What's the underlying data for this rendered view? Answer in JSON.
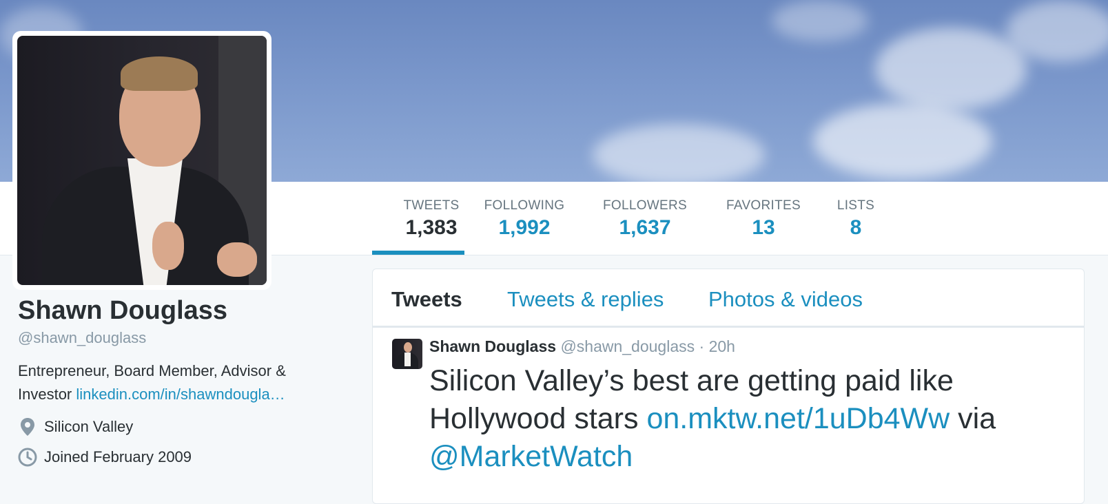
{
  "profile": {
    "name": "Shawn Douglass",
    "handle": "@shawn_douglass",
    "bio_text": "Entrepreneur, Board Member, Advisor & Investor",
    "bio_link": "linkedin.com/in/shawndougla…",
    "location": "Silicon Valley",
    "joined": "Joined February 2009"
  },
  "stats": [
    {
      "label": "TWEETS",
      "value": "1,383"
    },
    {
      "label": "FOLLOWING",
      "value": "1,992"
    },
    {
      "label": "FOLLOWERS",
      "value": "1,637"
    },
    {
      "label": "FAVORITES",
      "value": "13"
    },
    {
      "label": "LISTS",
      "value": "8"
    }
  ],
  "tabs": [
    "Tweets",
    "Tweets & replies",
    "Photos & videos"
  ],
  "tweet": {
    "name": "Shawn Douglass",
    "handle": "@shawn_douglass",
    "separator": " · ",
    "time": "20h",
    "text_a": "Silicon Valley’s best are getting paid like Hollywood stars ",
    "link": "on.mktw.net/1uDb4Ww",
    "text_b": " via ",
    "mention": "@MarketWatch"
  },
  "colors": {
    "accent": "#1b8fbf",
    "text": "#292f33",
    "muted": "#8899a6",
    "background": "#f5f8fa"
  },
  "icons": {
    "location": "map-pin-icon",
    "joined": "clock-icon"
  }
}
